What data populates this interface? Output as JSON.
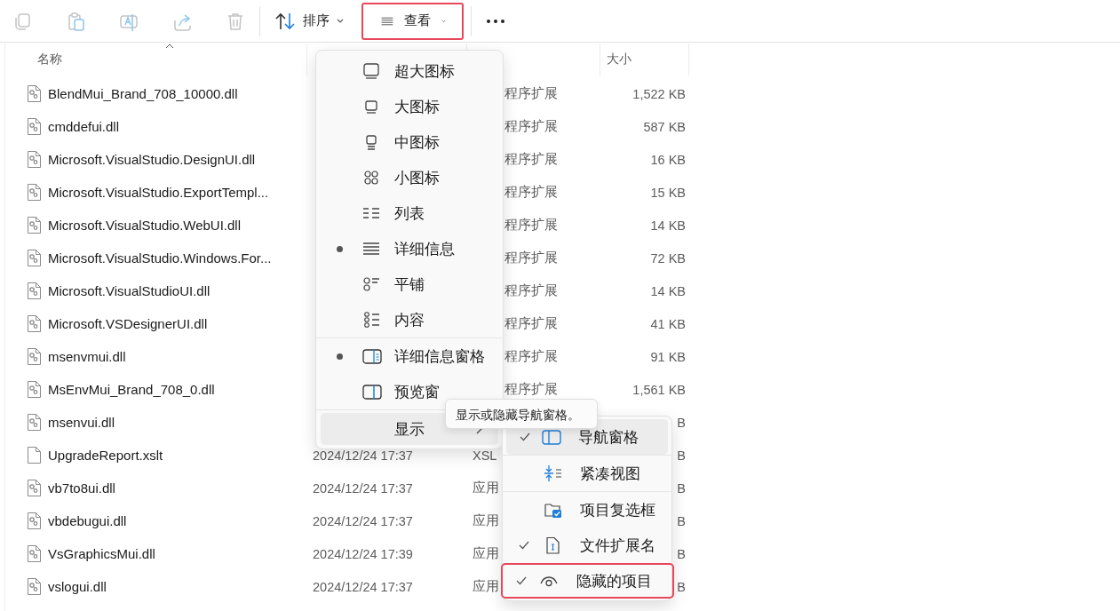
{
  "toolbar": {
    "actions": [
      {
        "disabled": true
      },
      {
        "disabled": true
      },
      {
        "disabled": true
      },
      {
        "disabled": true
      },
      {
        "disabled": true
      }
    ],
    "sort": {
      "label": "排序"
    },
    "view": {
      "label": "查看",
      "annotated": true
    }
  },
  "columns": [
    {
      "kind": "name",
      "label": "名称",
      "sorted": true
    },
    {
      "kind": "date"
    },
    {
      "kind": "type"
    },
    {
      "kind": "size",
      "label": "大小"
    }
  ],
  "rows": [
    {
      "name": "BlendMui_Brand_708_10000.dll",
      "kind": "dll",
      "type": "程序扩展",
      "size": "1,522 KB"
    },
    {
      "name": "cmddefui.dll",
      "kind": "dll",
      "type": "程序扩展",
      "size": "587 KB"
    },
    {
      "name": "Microsoft.VisualStudio.DesignUI.dll",
      "kind": "dll",
      "type": "程序扩展",
      "size": "16 KB"
    },
    {
      "name": "Microsoft.VisualStudio.ExportTempl...",
      "kind": "dll",
      "type": "程序扩展",
      "size": "15 KB"
    },
    {
      "name": "Microsoft.VisualStudio.WebUI.dll",
      "kind": "dll",
      "type": "程序扩展",
      "size": "14 KB"
    },
    {
      "name": "Microsoft.VisualStudio.Windows.For...",
      "kind": "dll",
      "type": "程序扩展",
      "size": "72 KB"
    },
    {
      "name": "Microsoft.VisualStudioUI.dll",
      "kind": "dll",
      "type": "程序扩展",
      "size": "14 KB"
    },
    {
      "name": "Microsoft.VSDesignerUI.dll",
      "kind": "dll",
      "type": "程序扩展",
      "size": "41 KB"
    },
    {
      "name": "msenvmui.dll",
      "kind": "dll",
      "type": "程序扩展",
      "size": "91 KB"
    },
    {
      "name": "MsEnvMui_Brand_708_0.dll",
      "kind": "dll",
      "type": "程序扩展",
      "size": "1,561 KB"
    },
    {
      "name": "msenvui.dll",
      "kind": "dll",
      "size": "B"
    },
    {
      "name": "UpgradeReport.xslt",
      "kind": "file",
      "date": "2024/12/24 17:37",
      "type": "XSL",
      "size": "B"
    },
    {
      "name": "vb7to8ui.dll",
      "kind": "dll",
      "date": "2024/12/24 17:37",
      "type": "应用",
      "size": "B"
    },
    {
      "name": "vbdebugui.dll",
      "kind": "dll",
      "date": "2024/12/24 17:37",
      "type": "应用",
      "size": "B"
    },
    {
      "name": "VsGraphicsMui.dll",
      "kind": "dll",
      "date": "2024/12/24 17:39",
      "type": "应用",
      "size": "B"
    },
    {
      "name": "vslogui.dll",
      "kind": "dll",
      "date": "2024/12/24 17:37",
      "type": "应用",
      "size": "B"
    }
  ],
  "view_menu": {
    "layouts": [
      {
        "label": "超大图标",
        "selected": false
      },
      {
        "label": "大图标",
        "selected": false
      },
      {
        "label": "中图标",
        "selected": false
      },
      {
        "label": "小图标",
        "selected": false
      },
      {
        "label": "列表",
        "selected": false
      },
      {
        "label": "详细信息",
        "selected": true
      },
      {
        "label": "平铺",
        "selected": false
      },
      {
        "label": "内容",
        "selected": false
      }
    ],
    "panes": [
      {
        "label": "详细信息窗格",
        "selected": true
      },
      {
        "label": "预览窗",
        "selected": false
      }
    ],
    "show": {
      "label": "显示",
      "highlighted": true
    }
  },
  "tooltip": {
    "text": "显示或隐藏导航窗格。"
  },
  "show_submenu": {
    "sections": [
      [
        {
          "label": "导航窗格",
          "checked": true,
          "highlighted": true,
          "annotated": false
        }
      ],
      [
        {
          "label": "紧凑视图",
          "checked": false,
          "highlighted": false,
          "annotated": false
        }
      ],
      [
        {
          "label": "项目复选框",
          "checked": false,
          "highlighted": false,
          "annotated": false
        },
        {
          "label": "文件扩展名",
          "checked": true,
          "highlighted": false,
          "annotated": false
        },
        {
          "label": "隐藏的项目",
          "checked": true,
          "highlighted": false,
          "annotated": true
        }
      ]
    ]
  }
}
